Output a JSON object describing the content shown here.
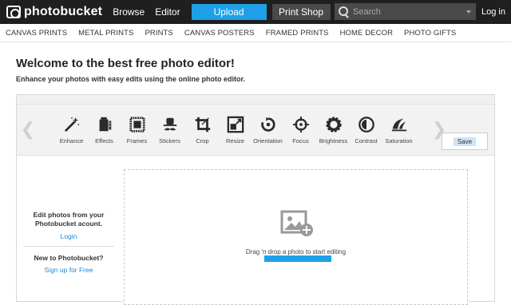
{
  "topnav": {
    "logo_text": "photobucket",
    "links": [
      "Browse",
      "Editor"
    ],
    "upload_label": "Upload",
    "printshop_label": "Print Shop",
    "search_placeholder": "Search",
    "login_label": "Log in"
  },
  "subnav": {
    "items": [
      "CANVAS PRINTS",
      "METAL PRINTS",
      "PRINTS",
      "CANVAS POSTERS",
      "FRAMED PRINTS",
      "HOME DECOR",
      "PHOTO GIFTS"
    ]
  },
  "hero": {
    "title": "Welcome to the best free photo editor!",
    "subtitle": "Enhance your photos with easy edits using the online photo editor."
  },
  "editor": {
    "tools": [
      {
        "label": "Enhance",
        "icon": "magic-wand-icon"
      },
      {
        "label": "Effects",
        "icon": "film-icon"
      },
      {
        "label": "Frames",
        "icon": "frame-icon"
      },
      {
        "label": "Stickers",
        "icon": "hat-mustache-icon"
      },
      {
        "label": "Crop",
        "icon": "crop-icon"
      },
      {
        "label": "Resize",
        "icon": "resize-icon"
      },
      {
        "label": "Orientation",
        "icon": "rotate-icon"
      },
      {
        "label": "Focus",
        "icon": "crosshair-icon"
      },
      {
        "label": "Brightness",
        "icon": "sun-icon"
      },
      {
        "label": "Contrast",
        "icon": "contrast-icon"
      },
      {
        "label": "Saturation",
        "icon": "saturation-icon"
      }
    ],
    "save_label": "Save",
    "left_panel": {
      "login_title": "Edit photos from your Photobucket acount.",
      "login_link": "Login",
      "signup_title": "New to Photobucket?",
      "signup_link": "Sign up for Free"
    },
    "dropzone_text": "Drag 'n drop a photo to start editing"
  },
  "colors": {
    "topbar": "#1f1f1f",
    "accent": "#1ea0e8",
    "link": "#1e88d8"
  }
}
